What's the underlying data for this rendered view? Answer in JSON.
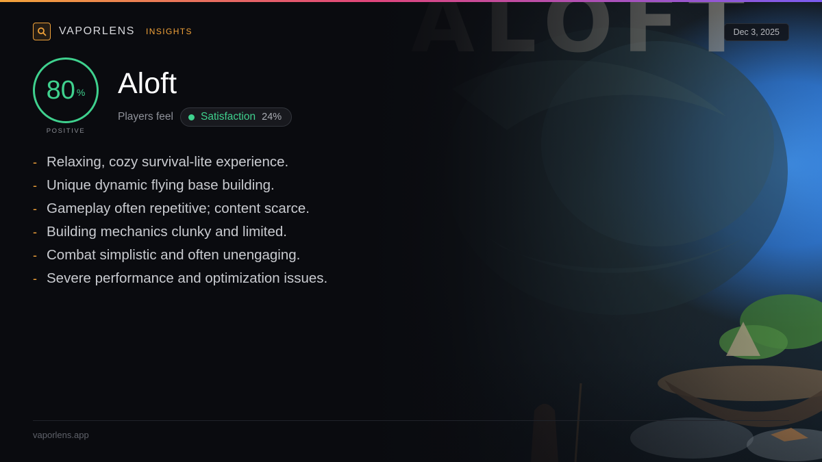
{
  "brand": {
    "name": "VAPORLENS",
    "tag": "INSIGHTS",
    "icon": "search-icon",
    "accent_color": "#f2a33a"
  },
  "date": "Dec 3, 2025",
  "score": {
    "value": "80",
    "unit": "%",
    "fraction": 0.8,
    "caption": "POSITIVE",
    "color": "#3fd18e"
  },
  "game": {
    "title": "Aloft"
  },
  "sentiment": {
    "prefix": "Players feel",
    "label": "Satisfaction",
    "percent": "24%"
  },
  "points": [
    "Relaxing, cozy survival-lite experience.",
    "Unique dynamic flying base building.",
    "Gameplay often repetitive; content scarce.",
    "Building mechanics clunky and limited.",
    "Combat simplistic and often unengaging.",
    "Severe performance and optimization issues."
  ],
  "footer": {
    "url": "vaporlens.app"
  }
}
